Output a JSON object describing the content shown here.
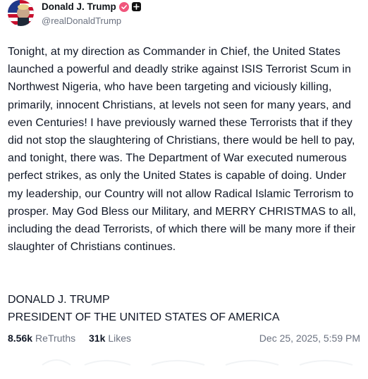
{
  "author": {
    "name": "Donald J. Trump",
    "handle": "@realDonaldTrump",
    "verified_icon": "verified-badge-icon",
    "extra_badge_icon": "plus-badge-icon",
    "accent_color": "#e0245e"
  },
  "post": {
    "body": "Tonight, at my direction as Commander in Chief, the United States launched a powerful and deadly strike against ISIS Terrorist Scum in Northwest Nigeria, who have been targeting and viciously killing, primarily, innocent Christians, at levels not seen for many years, and even Centuries! I have previously warned these Terrorists that if they did not stop the slaughtering of Christians, there would be hell to pay, and tonight, there was. The Department of War executed numerous perfect strikes, as only the United States is capable of doing. Under my leadership, our Country will not allow Radical Islamic Terrorism to prosper. May God Bless our Military, and MERRY CHRISTMAS to all, including the dead Terrorists, of which there will be many more if their slaughter of Christians continues.",
    "signature_line1": "DONALD J. TRUMP",
    "signature_line2": "PRESIDENT OF THE UNITED STATES OF AMERICA"
  },
  "stats": {
    "retruths_count": "8.56k",
    "retruths_label": "ReTruths",
    "likes_count": "31k",
    "likes_label": "Likes",
    "timestamp": "Dec 25, 2025, 5:59 PM"
  }
}
